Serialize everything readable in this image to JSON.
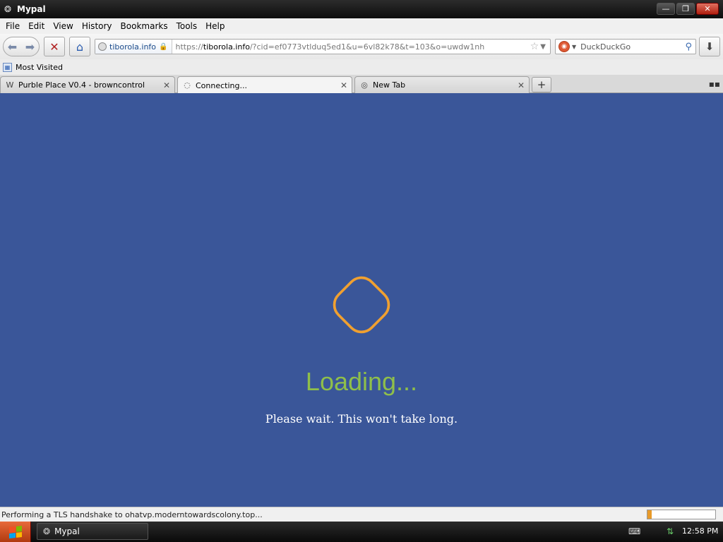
{
  "window": {
    "title": "Mypal",
    "controls": {
      "minimize": "—",
      "restore": "❐",
      "close": "✕"
    }
  },
  "menubar": {
    "items": [
      "File",
      "Edit",
      "View",
      "History",
      "Bookmarks",
      "Tools",
      "Help"
    ]
  },
  "navbar": {
    "identity_label": "tiborola.info",
    "url_prefix": "https://",
    "url_host": "tiborola.info",
    "url_rest": "/?cid=ef0773vtlduq5ed1&u=6vl82k78&t=103&o=uwdw1nh",
    "search_placeholder": "DuckDuckGo"
  },
  "bookmarks": {
    "items": [
      {
        "label": "Most Visited"
      }
    ]
  },
  "tabs": [
    {
      "label": "Purble Place V0.4 - browncontrol",
      "icon": "W"
    },
    {
      "label": "Connecting...",
      "icon": "◌"
    },
    {
      "label": "New Tab",
      "icon": "◎"
    }
  ],
  "content": {
    "heading": "Loading...",
    "subtext": "Please wait. This won't take long.",
    "spinner_color": "#f0a030",
    "background_color": "#3a5699",
    "heading_color": "#8fbf4a"
  },
  "statusbar": {
    "text": "Performing a TLS handshake to ohatvp.moderntowardscolony.top...",
    "progress_fraction": 0.06
  },
  "taskbar": {
    "task_label": "Mypal",
    "clock": "12:58 PM"
  }
}
